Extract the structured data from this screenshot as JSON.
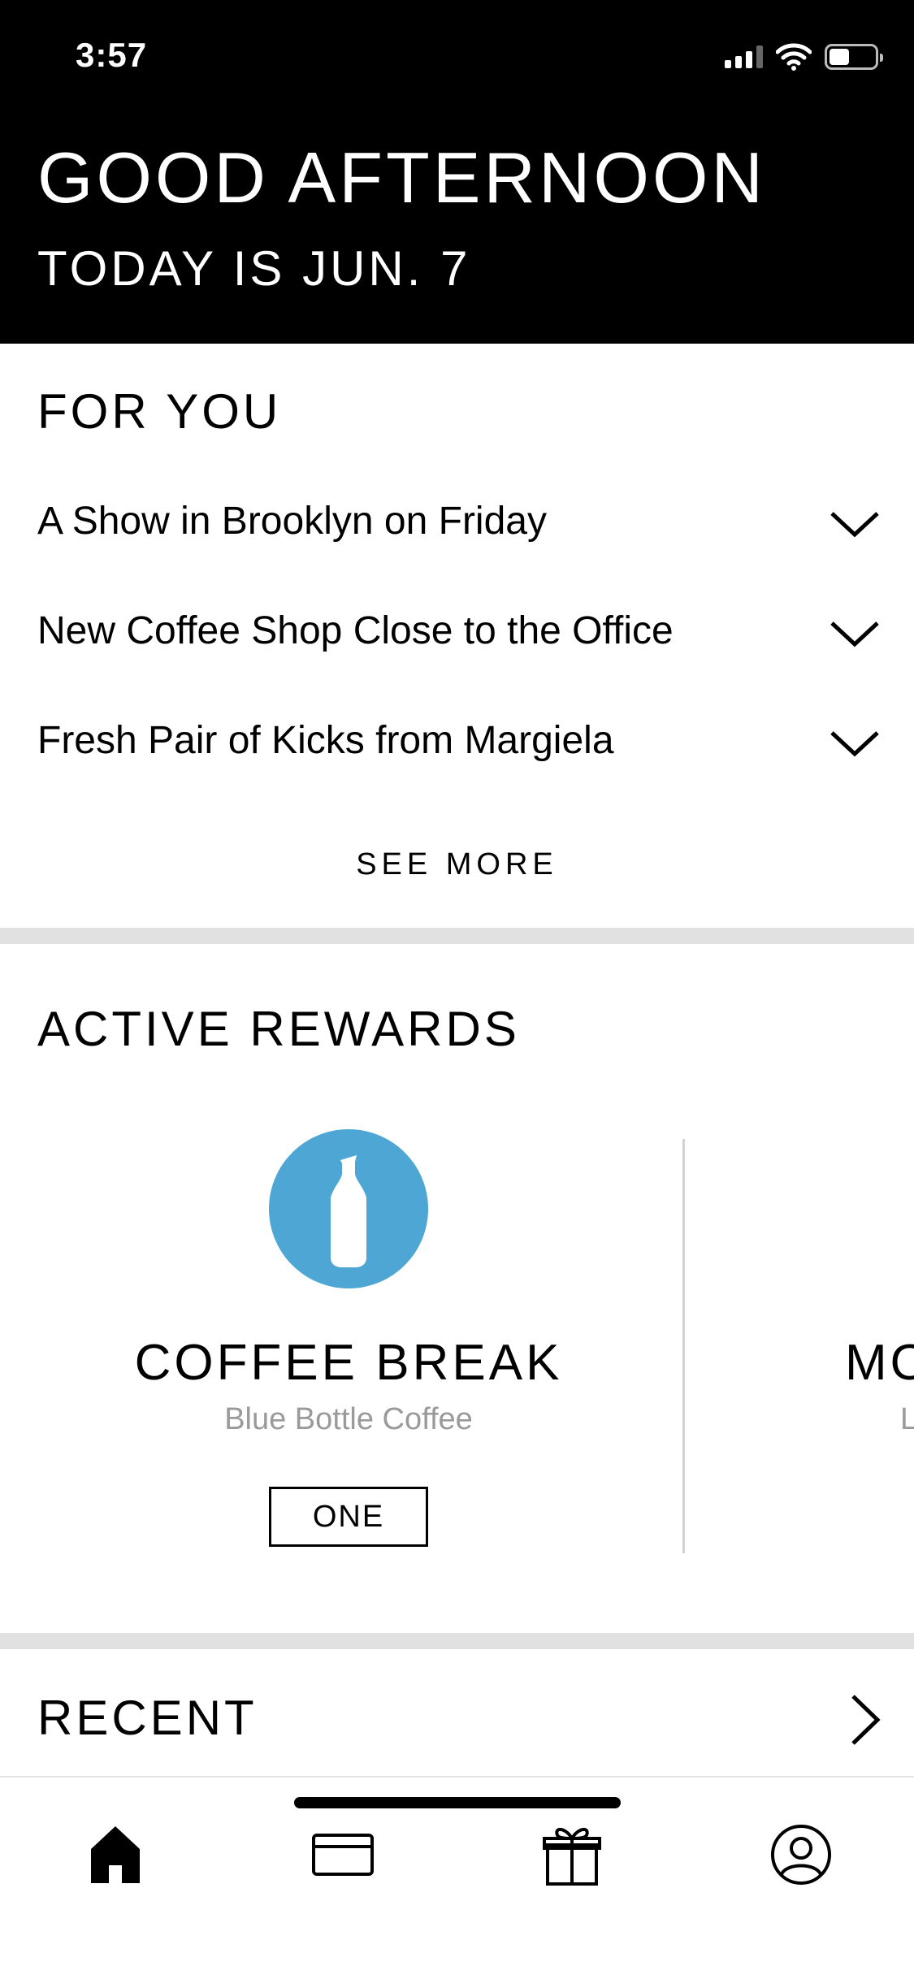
{
  "status_bar": {
    "time": "3:57"
  },
  "header": {
    "greeting": "GOOD AFTERNOON",
    "date_line": "TODAY IS JUN. 7"
  },
  "for_you": {
    "title": "FOR YOU",
    "items": [
      {
        "label": "A Show in Brooklyn on Friday"
      },
      {
        "label": "New Coffee Shop Close to the Office"
      },
      {
        "label": "Fresh Pair of Kicks from Margiela"
      }
    ],
    "see_more": "SEE MORE"
  },
  "active_rewards": {
    "title": "ACTIVE REWARDS",
    "cards": [
      {
        "name": "COFFEE BREAK",
        "merchant": "Blue Bottle Coffee",
        "badge": "ONE",
        "logo_color": "#4da6d4"
      }
    ],
    "peek": {
      "name": "MO",
      "merchant": "L"
    }
  },
  "recent": {
    "title": "RECENT"
  },
  "tabbar": {
    "tabs": [
      {
        "icon": "home-icon",
        "active": true
      },
      {
        "icon": "card-icon",
        "active": false
      },
      {
        "icon": "gift-icon",
        "active": false
      },
      {
        "icon": "profile-icon",
        "active": false
      }
    ]
  },
  "colors": {
    "header_bg": "#000000",
    "divider": "#e1e1e1",
    "accent": "#4da6d4",
    "muted_text": "#9a9a9a"
  }
}
